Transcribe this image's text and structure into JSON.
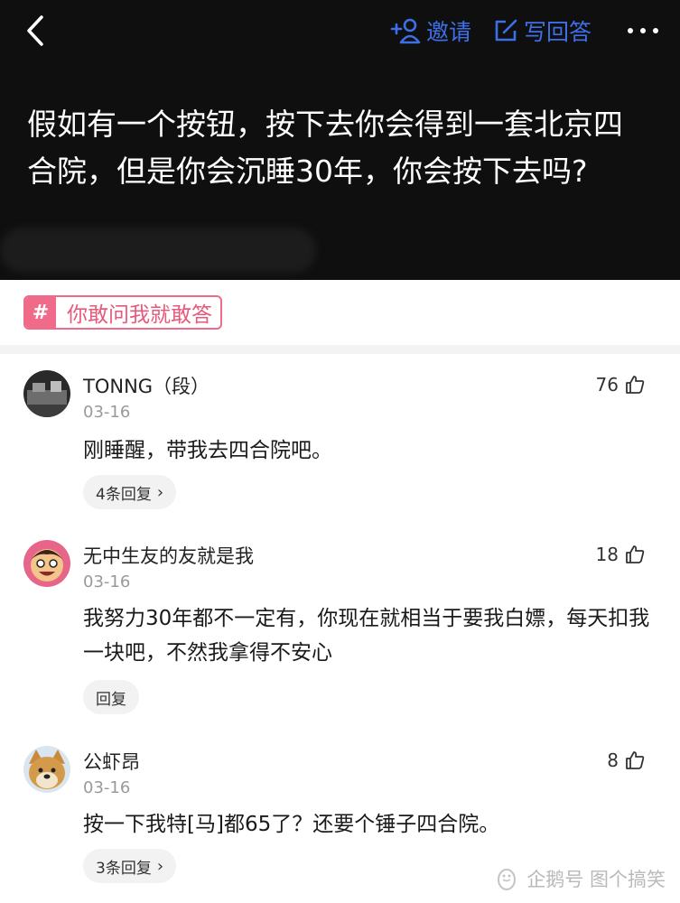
{
  "nav": {
    "invite_label": "邀请",
    "write_label": "写回答",
    "accent_color": "#3d6fe8"
  },
  "question": {
    "title": "假如有一个按钮，按下去你会得到一套北京四合院，但是你会沉睡30年，你会按下去吗?"
  },
  "topic": {
    "label": "你敢问我就敢答",
    "color": "#f06a8a"
  },
  "comments": [
    {
      "name": "TONNG（段）",
      "date": "03-16",
      "likes": "76",
      "text": "刚睡醒，带我去四合院吧。",
      "reply_label": "4条回复"
    },
    {
      "name": "无中生友的友就是我",
      "date": "03-16",
      "likes": "18",
      "text": "我努力30年都不一定有，你现在就相当于要我白嫖，每天扣我一块吧，不然我拿得不安心",
      "reply_label": "回复"
    },
    {
      "name": "公虾昂",
      "date": "03-16",
      "likes": "8",
      "text": "按一下我特[马]都65了？还要个锤子四合院。",
      "reply_label": "3条回复"
    }
  ],
  "watermark": {
    "text": "企鹅号 图个搞笑"
  }
}
